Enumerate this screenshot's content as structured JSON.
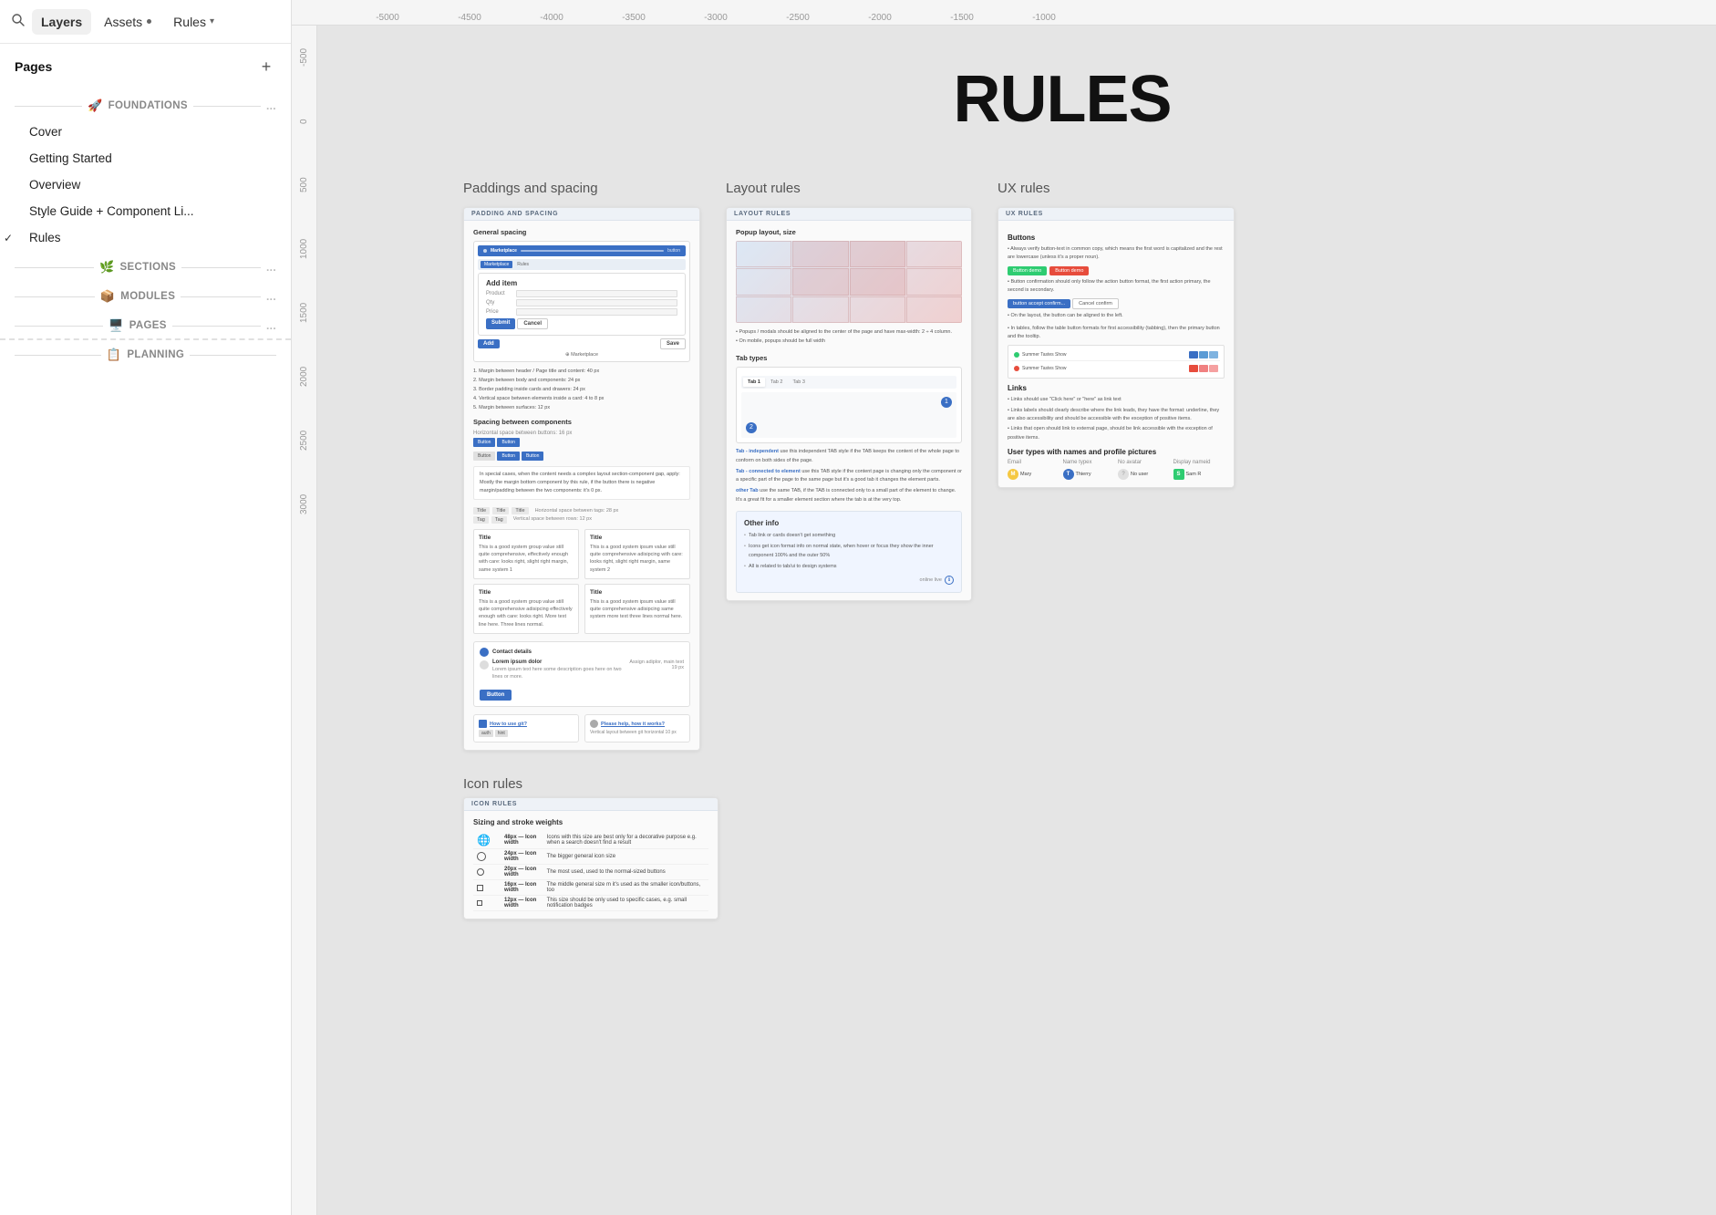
{
  "nav": {
    "search_icon": "🔍",
    "layers_label": "Layers",
    "assets_label": "Assets",
    "rules_label": "Rules",
    "rules_arrow": "▾"
  },
  "sidebar": {
    "pages_label": "Pages",
    "add_icon": "+",
    "items": [
      {
        "id": "foundations",
        "label": "FOUNDATIONS",
        "type": "section",
        "emoji": "🚀",
        "indent": false
      },
      {
        "id": "cover",
        "label": "Cover",
        "type": "page",
        "indent": true
      },
      {
        "id": "getting-started",
        "label": "Getting Started",
        "type": "page",
        "indent": true
      },
      {
        "id": "overview",
        "label": "Overview",
        "type": "page",
        "indent": true
      },
      {
        "id": "style-guide",
        "label": "Style Guide + Component Li...",
        "type": "page",
        "indent": true
      },
      {
        "id": "rules",
        "label": "Rules",
        "type": "page",
        "indent": true,
        "active": true
      },
      {
        "id": "sections",
        "label": "SECTIONS",
        "type": "section",
        "emoji": "🌿",
        "indent": false
      },
      {
        "id": "modules",
        "label": "MODULES",
        "type": "section",
        "emoji": "📦",
        "indent": false
      },
      {
        "id": "pages-section",
        "label": "PAGES",
        "type": "section",
        "emoji": "🖥️",
        "indent": false
      },
      {
        "id": "planning",
        "label": "PLANNING",
        "type": "section",
        "emoji": "📋",
        "indent": false
      }
    ]
  },
  "ruler": {
    "top_marks": [
      "-5000",
      "-4500",
      "-4000",
      "-3500",
      "-3000",
      "-2500",
      "-2000",
      "-1500",
      "-1000"
    ],
    "left_marks": [
      "-500",
      "0",
      "500",
      "1000",
      "1500",
      "2000",
      "2500",
      "3000"
    ]
  },
  "canvas": {
    "title": "RULES",
    "frames": [
      {
        "id": "paddings",
        "label": "Paddings and spacing",
        "section_title": "PADDING AND SPACING",
        "subsections": [
          "General spacing",
          "Spacing between components"
        ]
      },
      {
        "id": "layout",
        "label": "Layout rules",
        "section_title": "LAYOUT RULES",
        "subsections": [
          "Popup layout, size",
          "Tab types",
          "Other info"
        ]
      },
      {
        "id": "ux",
        "label": "UX rules",
        "section_title": "UX RULES",
        "subsections": [
          "Buttons",
          "Links",
          "User types with names and profile pictures"
        ]
      }
    ],
    "second_row": [
      {
        "id": "icon-rules",
        "label": "Icon rules",
        "section_title": "ICON RULES",
        "subsections": [
          "Sizing and stroke weights"
        ]
      }
    ]
  },
  "other_info": {
    "title": "Other info",
    "bullets": [
      "Tab link or cards doesn't get something",
      "Icons get icon format info on normal state, when hover or focus they show the inner component 100% and the outer 50%",
      "All related to tab/ui to design systems"
    ]
  },
  "icon_rules": {
    "title": "Sizing and stroke weights",
    "sizes": [
      {
        "size": "48px",
        "use": "Icon only use this size for a decorative purpose e.g. when a search doesn't find a result"
      },
      {
        "size": "24px",
        "use": "The bigger general icon size"
      },
      {
        "size": "20px",
        "use": "The most used, used to the normal-sized buttons"
      },
      {
        "size": "16px",
        "use": "The middle general size m it's used as the smaller icon/buttons, too"
      },
      {
        "size": "12px",
        "use": "This size should be only used to specific cases, e.g. small notification badges"
      }
    ]
  }
}
